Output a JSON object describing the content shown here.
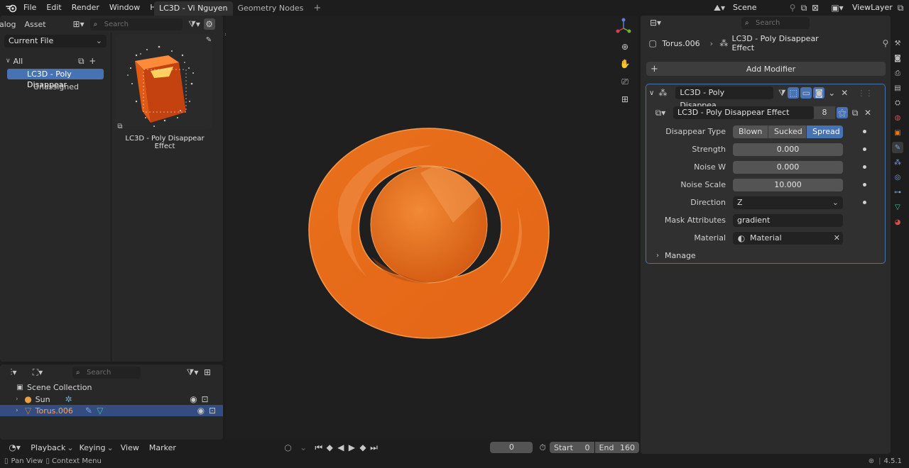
{
  "topbar": {
    "menus": [
      "File",
      "Edit",
      "Render",
      "Window",
      "Help"
    ],
    "tabs": [
      {
        "label": "LC3D - Vi Nguyen",
        "active": true
      },
      {
        "label": "Geometry Nodes",
        "active": false
      }
    ],
    "add_tab": "+",
    "scene": "Scene",
    "view_layer": "ViewLayer"
  },
  "asset_browser": {
    "catalog_tab": "alog",
    "asset_tab": "Asset",
    "search_placeholder": "Search",
    "library": "Current File",
    "tree": {
      "root": "All",
      "items": [
        {
          "label": "LC3D - Poly Disappear",
          "selected": true
        },
        {
          "label": "Unassigned",
          "selected": false
        }
      ]
    },
    "thumbnail_label": "LC3D - Poly Disappear Effect"
  },
  "outliner": {
    "search_placeholder": "Search",
    "collection": "Scene Collection",
    "items": [
      {
        "label": "Sun",
        "selected": false
      },
      {
        "label": "Torus.006",
        "selected": true
      }
    ]
  },
  "timeline": {
    "menus": [
      "Playback",
      "Keying",
      "View",
      "Marker"
    ],
    "current_frame": "0",
    "start_label": "Start",
    "start": "0",
    "end_label": "End",
    "end": "160"
  },
  "statusbar": {
    "left1": "Pan View",
    "left2": "Context Menu",
    "version": "4.5.1"
  },
  "properties": {
    "search_placeholder": "Search",
    "breadcrumb_object": "Torus.006",
    "breadcrumb_modifier": "LC3D - Poly Disappear Effect",
    "add_modifier": "Add Modifier",
    "modifier_name": "LC3D - Poly Disappea...",
    "node_group": "LC3D - Poly Disappear Effect",
    "node_group_users": "8",
    "disappear_type_label": "Disappear Type",
    "disappear_types": [
      "Blown",
      "Sucked",
      "Spread"
    ],
    "disappear_type_selected": "Spread",
    "strength_label": "Strength",
    "strength": "0.000",
    "noise_w_label": "Noise W",
    "noise_w": "0.000",
    "noise_scale_label": "Noise Scale",
    "noise_scale": "10.000",
    "direction_label": "Direction",
    "direction": "Z",
    "mask_label": "Mask Attributes",
    "mask": "gradient",
    "material_label": "Material",
    "material": "Material",
    "manage_label": "Manage"
  },
  "colors": {
    "accent": "#4772b3",
    "object_orange": "#e8781e",
    "bg": "#1d1d1d"
  }
}
